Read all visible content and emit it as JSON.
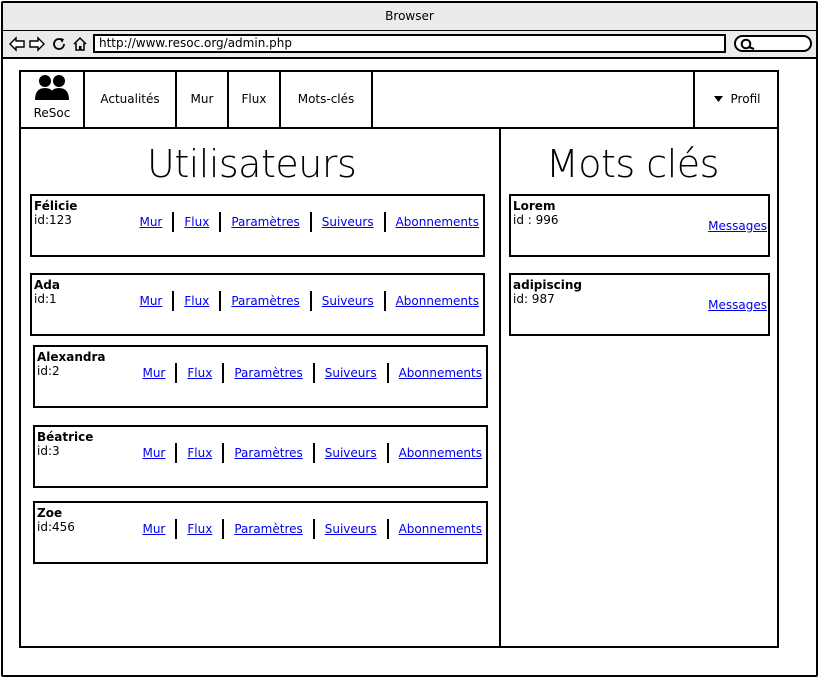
{
  "browser": {
    "title": "Browser",
    "url": "http://www.resoc.org/admin.php"
  },
  "header": {
    "logo_text": "ReSoc",
    "nav": [
      "Actualités",
      "Mur",
      "Flux",
      "Mots-clés"
    ],
    "profile_label": "Profil"
  },
  "users_section": {
    "title": "Utilisateurs",
    "link_labels": [
      "Mur",
      "Flux",
      "Paramètres",
      "Suiveurs",
      "Abonnements"
    ],
    "users": [
      {
        "name": "Félicie",
        "id": "id:123"
      },
      {
        "name": "Ada",
        "id": "id:1"
      },
      {
        "name": "Alexandra",
        "id": "id:2"
      },
      {
        "name": "Béatrice",
        "id": "id:3"
      },
      {
        "name": "Zoe",
        "id": "id:456"
      }
    ]
  },
  "keywords_section": {
    "title": "Mots clés",
    "link_label": "Messages",
    "keywords": [
      {
        "name": "Lorem",
        "id": "id : 996"
      },
      {
        "name": "adipiscing",
        "id": "id: 987"
      }
    ]
  }
}
